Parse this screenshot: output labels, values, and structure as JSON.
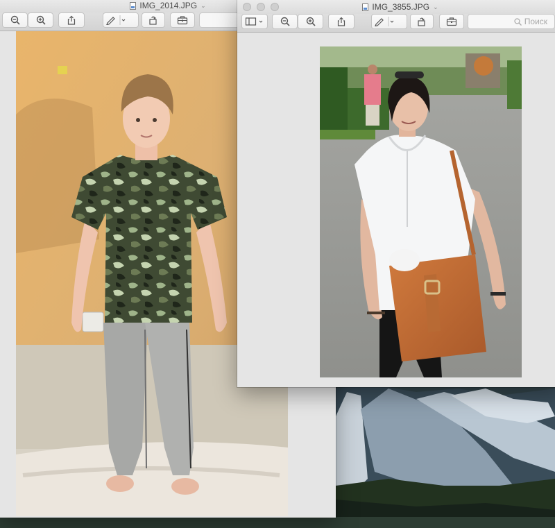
{
  "windows": [
    {
      "title": "IMG_2014.JPG",
      "photo_alt": "boy-in-camouflage-shirt-photo"
    },
    {
      "title": "IMG_3855.JPG",
      "photo_alt": "woman-with-brown-bag-photo",
      "search_placeholder": "Поиск"
    }
  ],
  "icons": {
    "sidebar": "sidebar-icon",
    "zoom_out": "zoom-out-icon",
    "zoom_in": "zoom-in-icon",
    "share": "share-icon",
    "markup": "pen-markup-icon",
    "rotate": "rotate-icon",
    "toolbox": "toolbox-icon",
    "search": "magnifier-icon"
  },
  "colors": {
    "window_bg": "#e6e6e6",
    "toolbar_bg": "#d8d8d8",
    "button_border": "#c3c3c3"
  }
}
